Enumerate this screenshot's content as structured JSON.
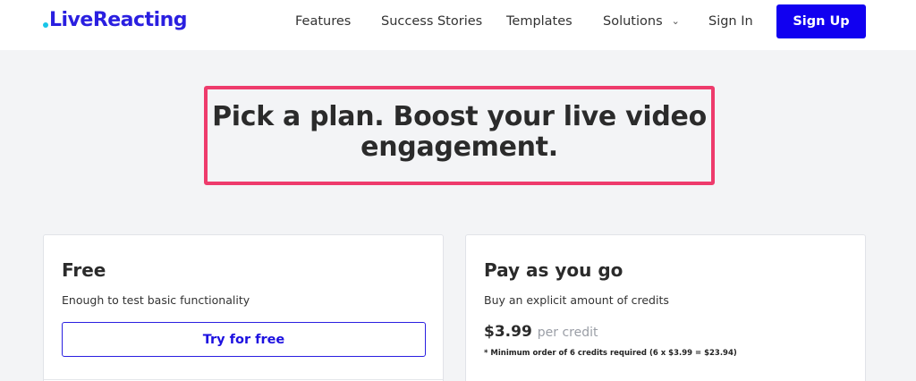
{
  "header": {
    "logo": "LiveReacting",
    "nav": {
      "features": "Features",
      "success_stories": "Success Stories",
      "templates": "Templates",
      "solutions": "Solutions",
      "sign_in": "Sign In"
    },
    "sign_up_label": "Sign Up"
  },
  "hero": {
    "title_line1": "Pick a plan. Boost your live video",
    "title_line2": "engagement."
  },
  "plans": {
    "free": {
      "name": "Free",
      "description": "Enough to test basic functionality",
      "button_label": "Try for free"
    },
    "pay_as_you_go": {
      "name": "Pay as you go",
      "description": "Buy an explicit amount of credits",
      "price": "$3.99",
      "price_unit": "per credit",
      "note": "* Minimum order of 6 credits required (6 x $3.99 = $23.94)"
    }
  },
  "colors": {
    "brand": "#2a1fe0",
    "primary_button": "#1100f0",
    "highlight": "#ee3b6c",
    "logo_dot": "#18c5e8",
    "background": "#f3f4f6"
  },
  "icons": {
    "solutions_dropdown": "chevron-down-icon",
    "logo_mark": "logo-dot-icon"
  }
}
